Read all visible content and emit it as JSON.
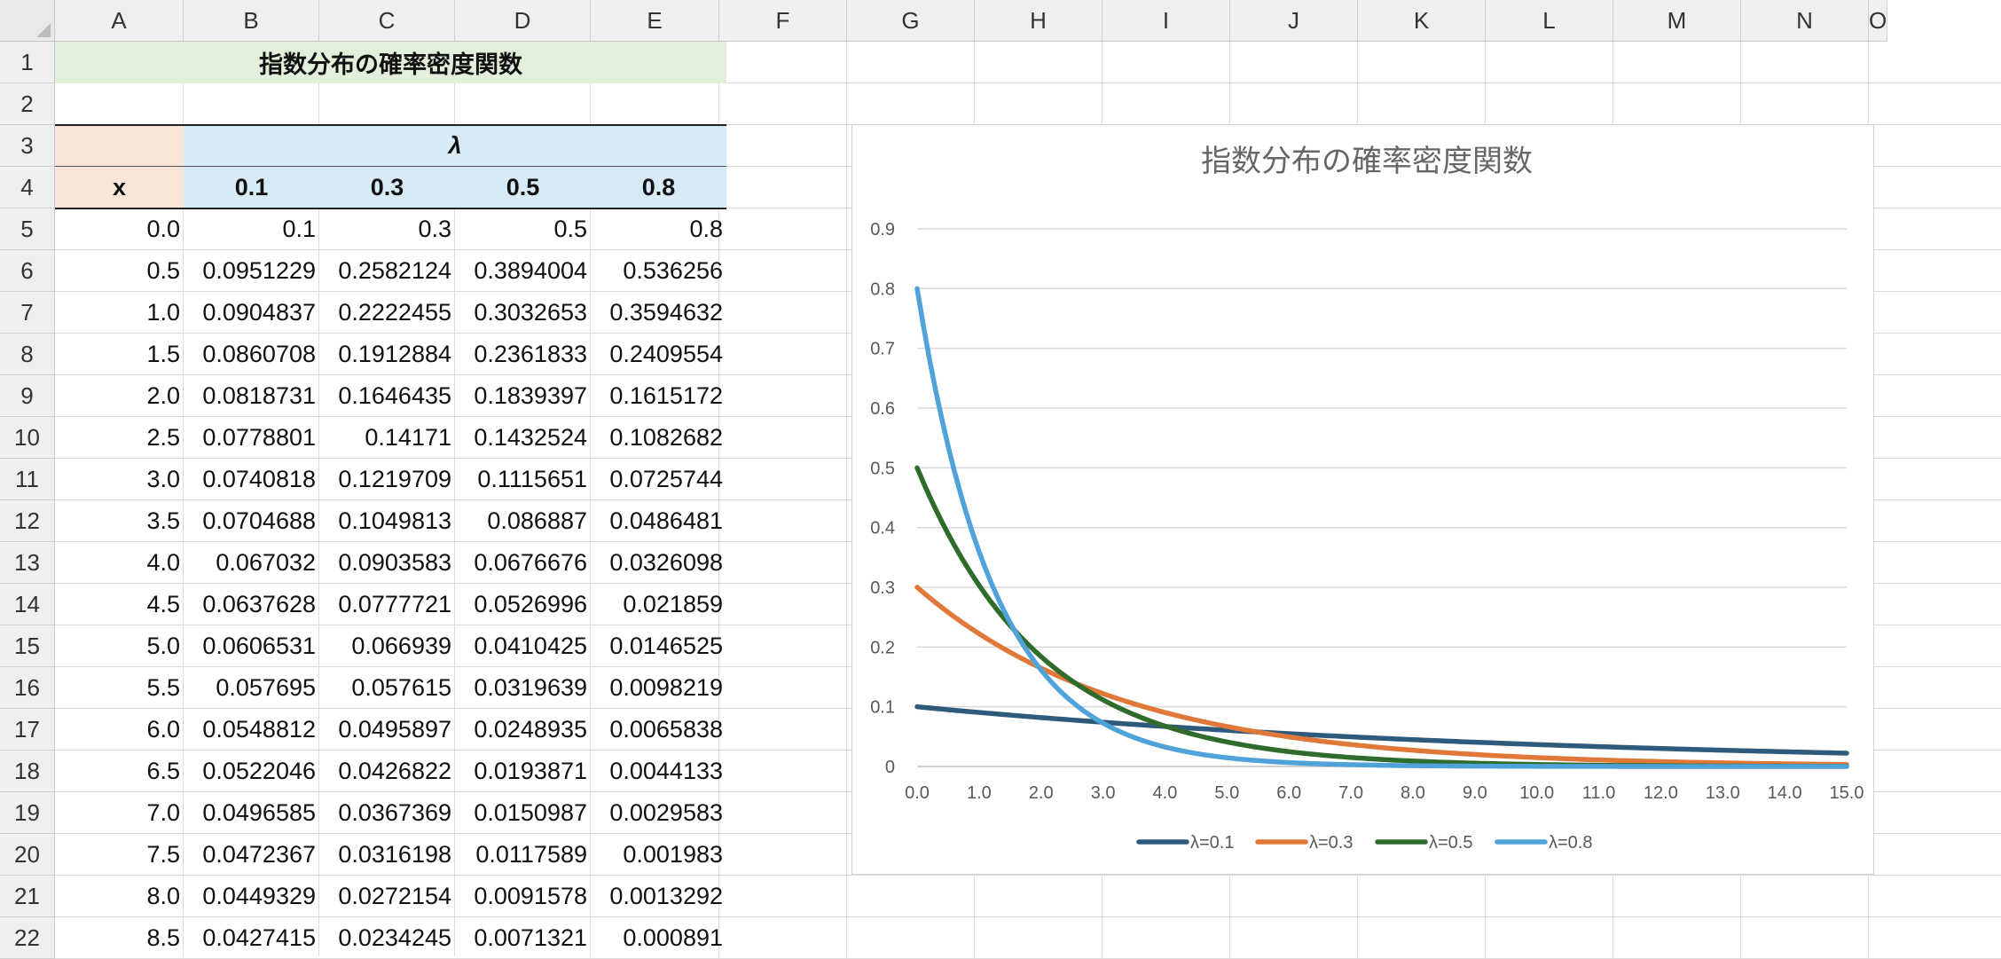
{
  "columns": [
    "A",
    "B",
    "C",
    "D",
    "E",
    "F",
    "G",
    "H",
    "I",
    "J",
    "K",
    "L",
    "M",
    "N",
    "O"
  ],
  "rows": [
    "1",
    "2",
    "3",
    "4",
    "5",
    "6",
    "7",
    "8",
    "9",
    "10",
    "11",
    "12",
    "13",
    "14",
    "15",
    "16",
    "17",
    "18",
    "19",
    "20",
    "21",
    "22"
  ],
  "sheet": {
    "title": "指数分布の確率密度関数",
    "lambda_header": "λ",
    "x_header": "x",
    "lambda_values": [
      "0.1",
      "0.3",
      "0.5",
      "0.8"
    ],
    "table_rows": [
      [
        "0.0",
        "0.1",
        "0.3",
        "0.5",
        "0.8"
      ],
      [
        "0.5",
        "0.0951229",
        "0.2582124",
        "0.3894004",
        "0.536256"
      ],
      [
        "1.0",
        "0.0904837",
        "0.2222455",
        "0.3032653",
        "0.3594632"
      ],
      [
        "1.5",
        "0.0860708",
        "0.1912884",
        "0.2361833",
        "0.2409554"
      ],
      [
        "2.0",
        "0.0818731",
        "0.1646435",
        "0.1839397",
        "0.1615172"
      ],
      [
        "2.5",
        "0.0778801",
        "0.14171",
        "0.1432524",
        "0.1082682"
      ],
      [
        "3.0",
        "0.0740818",
        "0.1219709",
        "0.1115651",
        "0.0725744"
      ],
      [
        "3.5",
        "0.0704688",
        "0.1049813",
        "0.086887",
        "0.0486481"
      ],
      [
        "4.0",
        "0.067032",
        "0.0903583",
        "0.0676676",
        "0.0326098"
      ],
      [
        "4.5",
        "0.0637628",
        "0.0777721",
        "0.0526996",
        "0.021859"
      ],
      [
        "5.0",
        "0.0606531",
        "0.066939",
        "0.0410425",
        "0.0146525"
      ],
      [
        "5.5",
        "0.057695",
        "0.057615",
        "0.0319639",
        "0.0098219"
      ],
      [
        "6.0",
        "0.0548812",
        "0.0495897",
        "0.0248935",
        "0.0065838"
      ],
      [
        "6.5",
        "0.0522046",
        "0.0426822",
        "0.0193871",
        "0.0044133"
      ],
      [
        "7.0",
        "0.0496585",
        "0.0367369",
        "0.0150987",
        "0.0029583"
      ],
      [
        "7.5",
        "0.0472367",
        "0.0316198",
        "0.0117589",
        "0.001983"
      ],
      [
        "8.0",
        "0.0449329",
        "0.0272154",
        "0.0091578",
        "0.0013292"
      ],
      [
        "8.5",
        "0.0427415",
        "0.0234245",
        "0.0071321",
        "0.000891"
      ]
    ]
  },
  "chart_data": {
    "type": "line",
    "title": "指数分布の確率密度関数",
    "xlabel": "",
    "ylabel": "",
    "x_ticks": [
      "0.0",
      "1.0",
      "2.0",
      "3.0",
      "4.0",
      "5.0",
      "6.0",
      "7.0",
      "8.0",
      "9.0",
      "10.0",
      "11.0",
      "12.0",
      "13.0",
      "14.0",
      "15.0"
    ],
    "y_ticks": [
      "0",
      "0.1",
      "0.2",
      "0.3",
      "0.4",
      "0.5",
      "0.6",
      "0.7",
      "0.8",
      "0.9"
    ],
    "xlim": [
      0,
      15
    ],
    "ylim": [
      0,
      0.9
    ],
    "grid": "horizontal",
    "legend": "bottom",
    "series": [
      {
        "name": "λ=0.1",
        "lambda": 0.1,
        "color": "#2e5a7c",
        "x": [
          0.0,
          0.5,
          1.0,
          1.5,
          2.0,
          2.5,
          3.0,
          3.5,
          4.0,
          4.5,
          5.0,
          5.5,
          6.0,
          6.5,
          7.0,
          7.5,
          8.0,
          8.5,
          9.0,
          9.5,
          10.0,
          10.5,
          11.0,
          11.5,
          12.0,
          12.5,
          13.0,
          13.5,
          14.0,
          14.5,
          15.0
        ],
        "y": [
          0.1,
          0.0951229,
          0.0904837,
          0.0860708,
          0.0818731,
          0.0778801,
          0.0740818,
          0.0704688,
          0.067032,
          0.0637628,
          0.0606531,
          0.057695,
          0.0548812,
          0.0522046,
          0.0496585,
          0.0472367,
          0.0449329,
          0.0427415,
          0.040657,
          0.0386741,
          0.0367879,
          0.0349938,
          0.0332871,
          0.0316637,
          0.0301194,
          0.0286505,
          0.0272532,
          0.025924,
          0.0246597,
          0.023457,
          0.022313
        ]
      },
      {
        "name": "λ=0.3",
        "lambda": 0.3,
        "color": "#e0783a",
        "x": [
          0.0,
          0.5,
          1.0,
          1.5,
          2.0,
          2.5,
          3.0,
          3.5,
          4.0,
          4.5,
          5.0,
          5.5,
          6.0,
          6.5,
          7.0,
          7.5,
          8.0,
          8.5,
          9.0,
          9.5,
          10.0,
          10.5,
          11.0,
          11.5,
          12.0,
          12.5,
          13.0,
          13.5,
          14.0,
          14.5,
          15.0
        ],
        "y": [
          0.3,
          0.2582124,
          0.2222455,
          0.1912884,
          0.1646435,
          0.14171,
          0.1219709,
          0.1049813,
          0.0903583,
          0.0777721,
          0.066939,
          0.057615,
          0.0495897,
          0.0426822,
          0.0367369,
          0.0316198,
          0.0272154,
          0.0234245,
          0.0201617,
          0.0173533,
          0.0149361,
          0.0128557,
          0.011065,
          0.0095237,
          0.0081971,
          0.0070554,
          0.0060726,
          0.0052268,
          0.0044987,
          0.0038721,
          0.0033327
        ]
      },
      {
        "name": "λ=0.5",
        "lambda": 0.5,
        "color": "#2f6b2a",
        "x": [
          0.0,
          0.5,
          1.0,
          1.5,
          2.0,
          2.5,
          3.0,
          3.5,
          4.0,
          4.5,
          5.0,
          5.5,
          6.0,
          6.5,
          7.0,
          7.5,
          8.0,
          8.5,
          9.0,
          9.5,
          10.0,
          10.5,
          11.0,
          11.5,
          12.0,
          12.5,
          13.0,
          13.5,
          14.0,
          14.5,
          15.0
        ],
        "y": [
          0.5,
          0.3894004,
          0.3032653,
          0.2361833,
          0.1839397,
          0.1432524,
          0.1115651,
          0.086887,
          0.0676676,
          0.0526996,
          0.0410425,
          0.0319639,
          0.0248935,
          0.0193871,
          0.0150987,
          0.0117589,
          0.0091578,
          0.0071321,
          0.0055545,
          0.0043259,
          0.003369,
          0.0026237,
          0.0020434,
          0.0015914,
          0.0012394,
          0.0009652,
          0.0007517,
          0.0005854,
          0.0004559,
          0.0003551,
          0.0002765
        ]
      },
      {
        "name": "λ=0.8",
        "lambda": 0.8,
        "color": "#4fa3d9",
        "x": [
          0.0,
          0.5,
          1.0,
          1.5,
          2.0,
          2.5,
          3.0,
          3.5,
          4.0,
          4.5,
          5.0,
          5.5,
          6.0,
          6.5,
          7.0,
          7.5,
          8.0,
          8.5,
          9.0,
          9.5,
          10.0,
          10.5,
          11.0,
          11.5,
          12.0,
          12.5,
          13.0,
          13.5,
          14.0,
          14.5,
          15.0
        ],
        "y": [
          0.8,
          0.536256,
          0.3594632,
          0.2409554,
          0.1615172,
          0.1082682,
          0.0725744,
          0.0486481,
          0.0326098,
          0.021859,
          0.0146525,
          0.0098219,
          0.0065838,
          0.0044133,
          0.0029583,
          0.001983,
          0.0013292,
          0.000891,
          0.0005973,
          0.0004004,
          0.0002684,
          0.0001799,
          0.0001206,
          8.08e-05,
          5.42e-05,
          3.63e-05,
          2.44e-05,
          1.63e-05,
          1.09e-05,
          7.3e-06,
          4.9e-06
        ]
      }
    ]
  }
}
